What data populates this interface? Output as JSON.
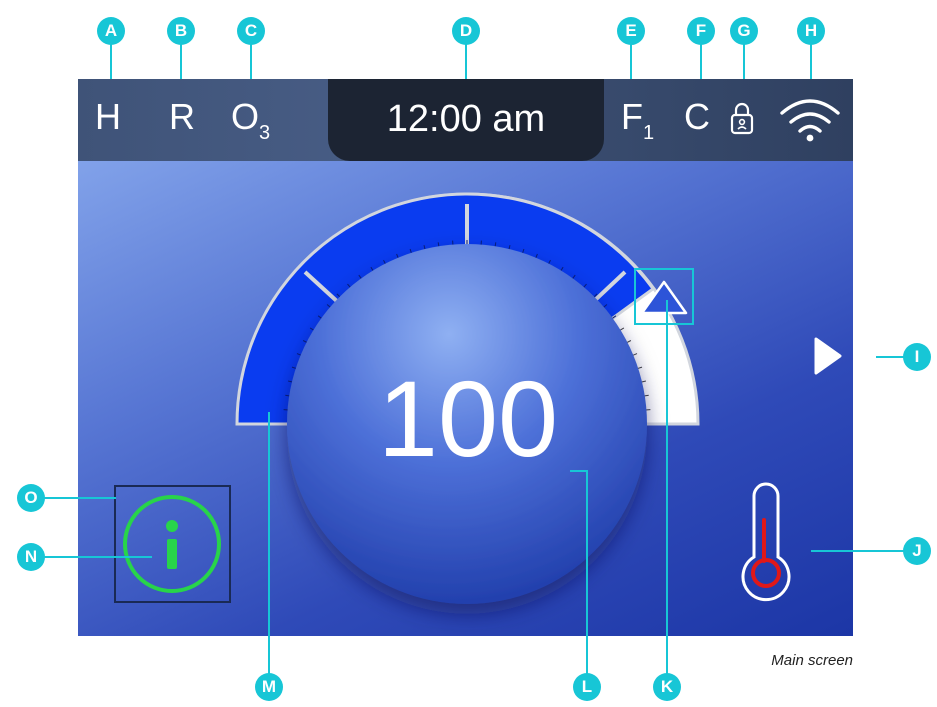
{
  "statusbar": {
    "left_items": [
      "H",
      "R",
      "O"
    ],
    "ozone_subscript": "3",
    "clock": "12:00 am",
    "filter_letter": "F",
    "filter_subscript": "1",
    "unit_letter": "C",
    "lock_icon": "lock-icon",
    "wifi_icon": "wifi-icon"
  },
  "dial": {
    "value": "100",
    "level_fraction": 0.8
  },
  "icons": {
    "next": "play-arrow-icon",
    "info": "info-icon",
    "thermometer": "thermometer-icon",
    "setpoint_marker": "triangle-marker-icon"
  },
  "callouts": [
    "A",
    "B",
    "C",
    "D",
    "E",
    "F",
    "G",
    "H",
    "I",
    "J",
    "K",
    "L",
    "M",
    "N",
    "O"
  ],
  "caption": "Main screen",
  "colors": {
    "callout": "#17c6d6",
    "gauge_fill": "#0a3cf0",
    "info_green": "#28d44a",
    "thermo_red": "#e01818",
    "statusbar": "#3f5378"
  }
}
